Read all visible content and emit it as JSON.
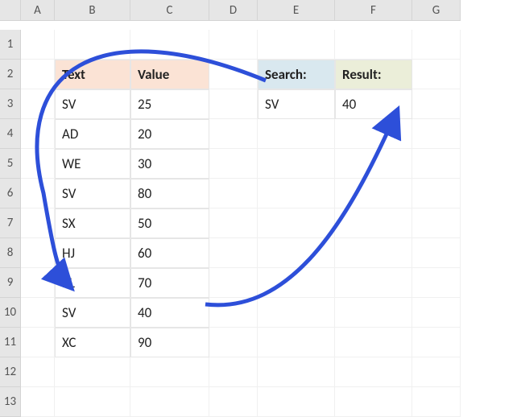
{
  "columns": [
    "",
    "A",
    "B",
    "C",
    "D",
    "E",
    "F",
    "G"
  ],
  "rows": [
    "1",
    "2",
    "3",
    "4",
    "5",
    "6",
    "7",
    "8",
    "9",
    "10",
    "11",
    "12",
    "13"
  ],
  "table": {
    "headers": {
      "text": "Text",
      "value": "Value"
    },
    "data": [
      {
        "text": "SV",
        "value": 25
      },
      {
        "text": "AD",
        "value": 20
      },
      {
        "text": "WE",
        "value": 30
      },
      {
        "text": "SV",
        "value": 80
      },
      {
        "text": "SX",
        "value": 50
      },
      {
        "text": "HJ",
        "value": 60
      },
      {
        "text": "KL",
        "value": 70
      },
      {
        "text": "SV",
        "value": 40
      },
      {
        "text": "XC",
        "value": 90
      }
    ]
  },
  "search": {
    "label": "Search:",
    "resultLabel": "Result:",
    "term": "SV",
    "result": 40
  },
  "arrow_color": "#2d4fd9"
}
